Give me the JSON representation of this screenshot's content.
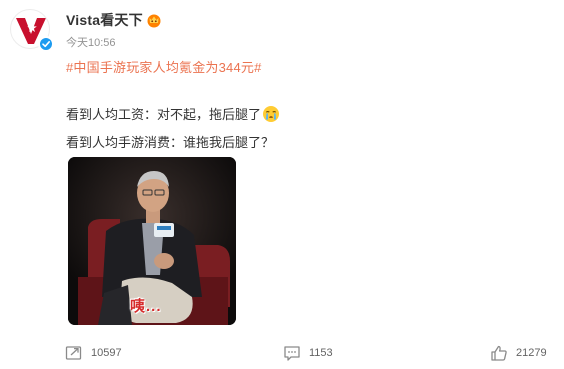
{
  "author": {
    "name": "Vista看天下",
    "avatar_icon": "vista-logo-icon",
    "verified_icon": "verified-check-icon",
    "badge_icon": "member-crown-icon"
  },
  "post": {
    "time": "今天10:56",
    "hashtag": "#中国手游玩家人均氪金为344元#",
    "line1": "看到人均工资：对不起，拖后腿了",
    "line1_emoji": "crying-face-icon",
    "line2": "看到人均手游消费：谁拖我后腿了？",
    "media": {
      "caption": "咦...",
      "kind": "reaction-meme-photo"
    }
  },
  "actions": {
    "repost": {
      "icon": "repost-icon",
      "count": "10597"
    },
    "comment": {
      "icon": "comment-icon",
      "count": "1153"
    },
    "like": {
      "icon": "thumbs-up-icon",
      "count": "21279"
    }
  },
  "colors": {
    "hashtag": "#eb7350",
    "brand_red": "#c8102e",
    "verified_blue": "#1d9bf0",
    "text": "#333333",
    "muted": "#939393"
  }
}
